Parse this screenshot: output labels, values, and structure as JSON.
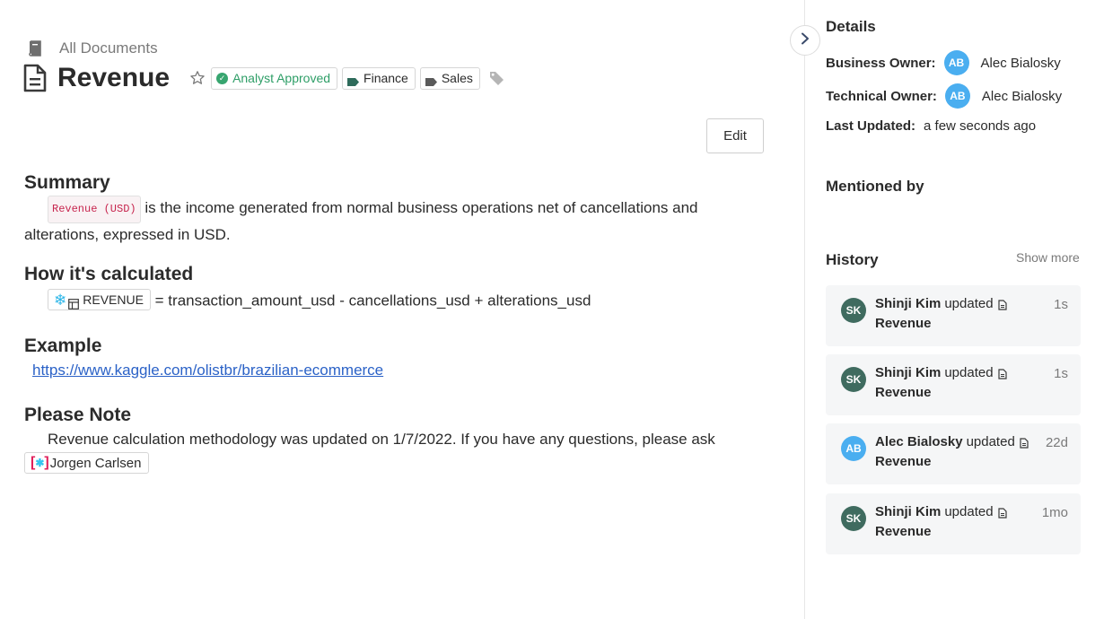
{
  "breadcrumb": {
    "label": "All Documents"
  },
  "document": {
    "title": "Revenue",
    "badges": {
      "approved": "Analyst Approved",
      "tags": [
        "Finance",
        "Sales"
      ]
    },
    "edit_label": "Edit"
  },
  "sections": {
    "summary": {
      "heading": "Summary",
      "code": "Revenue (USD)",
      "text_line1": " is the income generated from normal business operations net of cancellations and",
      "text_line2": "alterations, expressed in USD."
    },
    "calculation": {
      "heading": "How it's calculated",
      "table_ref": "REVENUE",
      "formula": " = transaction_amount_usd - cancellations_usd + alterations_usd"
    },
    "example": {
      "heading": "Example",
      "link": "https://www.kaggle.com/olistbr/brazilian-ecommerce"
    },
    "note": {
      "heading": "Please Note",
      "text": "Revenue calculation methodology was updated on 1/7/2022. If you have any questions, please ask",
      "person": "Jorgen Carlsen"
    }
  },
  "panel": {
    "details_heading": "Details",
    "business_owner_label": "Business Owner:",
    "business_owner": {
      "initials": "AB",
      "name": "Alec Bialosky"
    },
    "technical_owner_label": "Technical Owner:",
    "technical_owner": {
      "initials": "AB",
      "name": "Alec Bialosky"
    },
    "last_updated_label": "Last Updated:",
    "last_updated": "a few seconds ago",
    "mentioned_heading": "Mentioned by",
    "history_heading": "History",
    "show_more": "Show more",
    "history": [
      {
        "initials": "SK",
        "user": "Shinji Kim",
        "action": "updated",
        "doc": "Revenue",
        "time": "1s"
      },
      {
        "initials": "SK",
        "user": "Shinji Kim",
        "action": "updated",
        "doc": "Revenue",
        "time": "1s"
      },
      {
        "initials": "AB",
        "user": "Alec Bialosky",
        "action": "updated",
        "doc": "Revenue",
        "time": "22d"
      },
      {
        "initials": "SK",
        "user": "Shinji Kim",
        "action": "updated",
        "doc": "Revenue",
        "time": "1mo"
      }
    ]
  },
  "colors": {
    "approved": "#2e9e67",
    "link": "#2b62c7",
    "avatar_ab": "#4aaef0",
    "avatar_sk": "#3f6b5f"
  },
  "icons": [
    "book-icon",
    "document-icon",
    "star-icon",
    "check-circle-icon",
    "tag-icon",
    "tag-add-icon",
    "snowflake-icon",
    "table-icon",
    "slack-icon",
    "chevron-right-icon"
  ]
}
